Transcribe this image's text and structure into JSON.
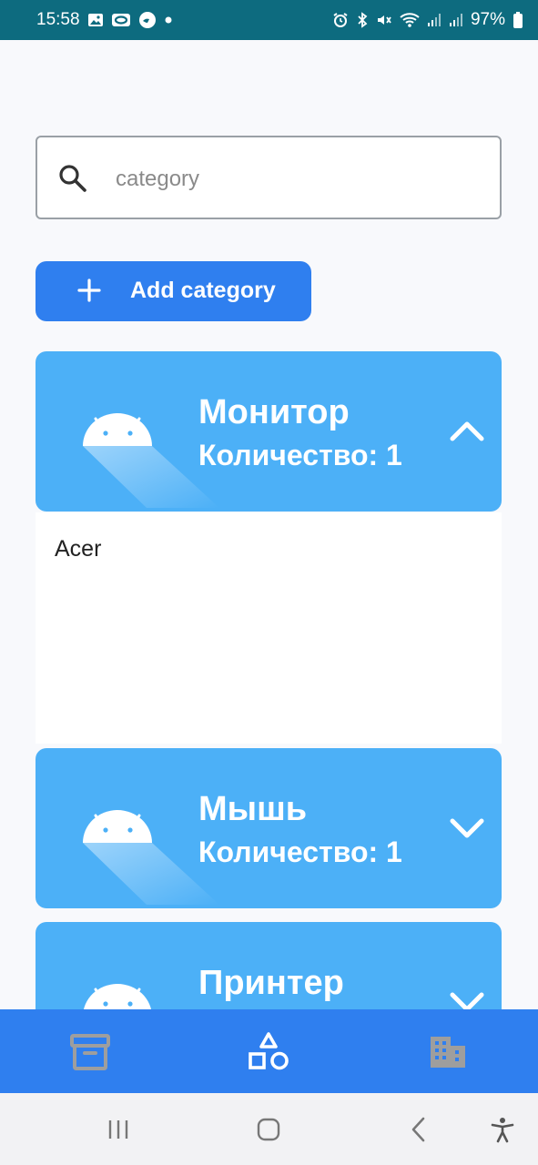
{
  "status_bar": {
    "time": "15:58",
    "battery": "97%",
    "left_icons": [
      "gallery-icon",
      "outlook-icon",
      "messenger-icon",
      "dot-icon"
    ],
    "right_icons": [
      "alarm-icon",
      "bluetooth-icon",
      "mute-icon",
      "wifi-icon",
      "signal-icon",
      "signal-icon",
      "battery-icon"
    ]
  },
  "search": {
    "placeholder": "category",
    "value": ""
  },
  "add_button": {
    "label": "Add category"
  },
  "categories": [
    {
      "title": "Монитор",
      "count_label": "Количество: 1",
      "expanded": true,
      "items": [
        "Acer"
      ]
    },
    {
      "title": "Мышь",
      "count_label": "Количество: 1",
      "expanded": false,
      "items": []
    },
    {
      "title": "Принтер",
      "count_label": "",
      "expanded": false,
      "items": []
    }
  ],
  "bottom_nav": [
    {
      "name": "archive",
      "icon": "archive-icon",
      "active": false
    },
    {
      "name": "categories",
      "icon": "shapes-icon",
      "active": true
    },
    {
      "name": "buildings",
      "icon": "building-icon",
      "active": false
    }
  ],
  "colors": {
    "status_bar": "#0d6b7f",
    "accent": "#2f7fef",
    "card": "#4cb0f7",
    "inactive_nav_icon": "#9e9e9e"
  }
}
